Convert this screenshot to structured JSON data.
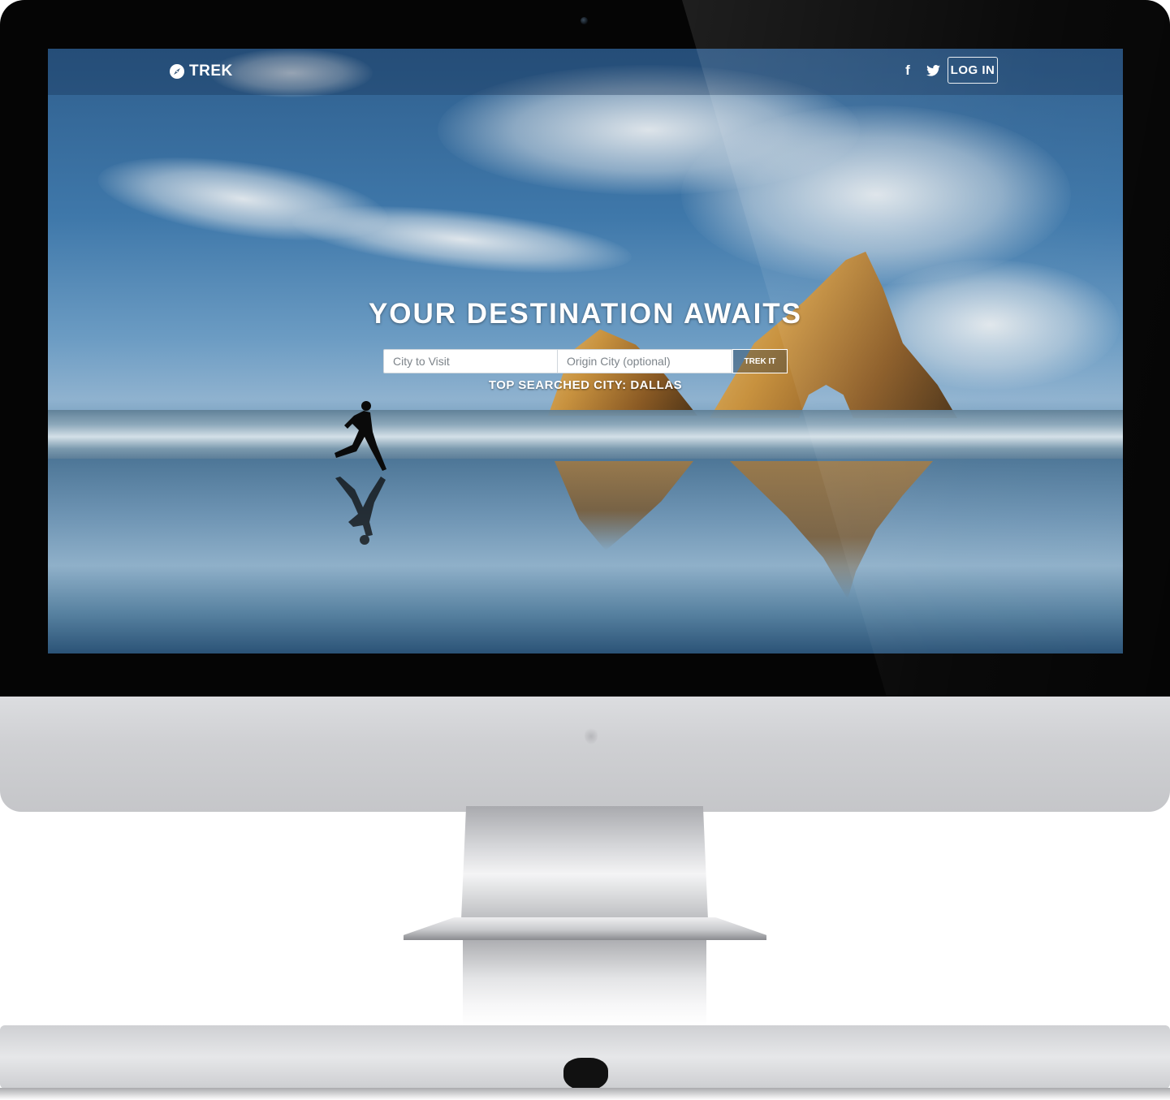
{
  "site": {
    "brand": {
      "name": "TREK",
      "icon": "compass-icon"
    },
    "nav": {
      "social": [
        {
          "name": "facebook",
          "icon": "facebook-icon",
          "glyph": "f"
        },
        {
          "name": "twitter",
          "icon": "twitter-icon"
        }
      ],
      "login_label": "LOG IN"
    },
    "hero": {
      "title": "YOUR DESTINATION AWAITS",
      "search": {
        "city_placeholder": "City to Visit",
        "origin_placeholder": "Origin City (optional)",
        "submit_label": "TREK IT"
      },
      "top_searched": "TOP SEARCHED CITY: DALLAS"
    }
  },
  "colors": {
    "text": "#ffffff",
    "navbar_overlay": "rgba(20,45,80,0.35)",
    "bezel": "#050505",
    "monitor_silver": "#cfd0d3"
  }
}
